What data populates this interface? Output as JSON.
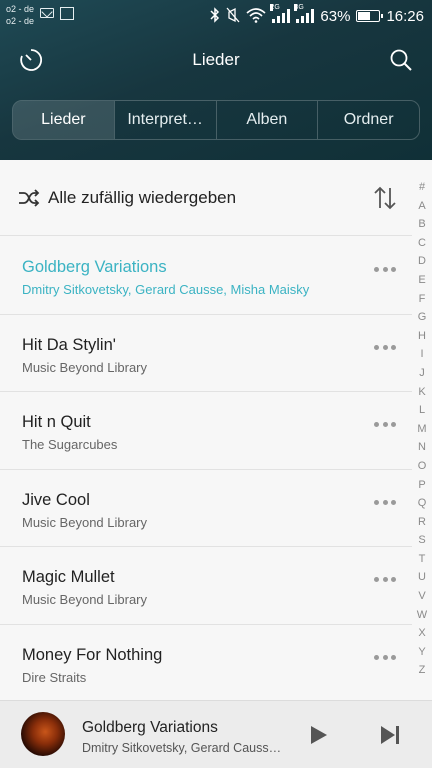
{
  "statusbar": {
    "carrier1": "o2 - de",
    "carrier2": "o2 - de",
    "net1": "2G",
    "net2": "3G",
    "battery": "63%",
    "battery_level": 0.63,
    "time": "16:26"
  },
  "header": {
    "title": "Lieder"
  },
  "tabs": [
    {
      "label": "Lieder",
      "active": true
    },
    {
      "label": "Interpret…"
    },
    {
      "label": "Alben"
    },
    {
      "label": "Ordner"
    }
  ],
  "shuffle": {
    "label": "Alle zufällig wiedergeben"
  },
  "songs": [
    {
      "title": "Goldberg Variations",
      "artist": "Dmitry Sitkovetsky, Gerard Causse, Misha Maisky",
      "playing": true
    },
    {
      "title": "Hit Da Stylin'",
      "artist": "Music Beyond Library"
    },
    {
      "title": "Hit n Quit",
      "artist": "The Sugarcubes"
    },
    {
      "title": "Jive Cool",
      "artist": "Music Beyond Library"
    },
    {
      "title": "Magic Mullet",
      "artist": "Music Beyond Library"
    },
    {
      "title": "Money For Nothing",
      "artist": "Dire Straits"
    }
  ],
  "index": [
    "#",
    "A",
    "B",
    "C",
    "D",
    "E",
    "F",
    "G",
    "H",
    "I",
    "J",
    "K",
    "L",
    "M",
    "N",
    "O",
    "P",
    "Q",
    "R",
    "S",
    "T",
    "U",
    "V",
    "W",
    "X",
    "Y",
    "Z"
  ],
  "player": {
    "title": "Goldberg Variations",
    "artist": "Dmitry Sitkovetsky, Gerard Causse, Misha Maisky"
  },
  "colors": {
    "accent": "#3bb3c3",
    "header": "#17363f"
  },
  "icons": [
    "timer-icon",
    "search-icon",
    "shuffle-icon",
    "sort-icon",
    "more-icon",
    "play-icon",
    "skip-next-icon"
  ]
}
